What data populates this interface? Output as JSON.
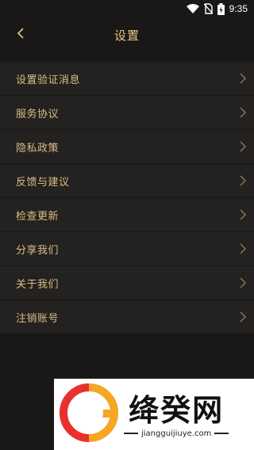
{
  "status": {
    "time": "9:35",
    "icons": [
      "wifi-icon",
      "no-sim-icon",
      "battery-charging-icon"
    ]
  },
  "header": {
    "title": "设置",
    "back_icon": "chevron-left-icon"
  },
  "menu": {
    "items": [
      {
        "label": "设置验证消息"
      },
      {
        "label": "服务协议"
      },
      {
        "label": "隐私政策"
      },
      {
        "label": "反馈与建议"
      },
      {
        "label": "检查更新"
      },
      {
        "label": "分享我们"
      },
      {
        "label": "关于我们"
      },
      {
        "label": "注销账号"
      }
    ],
    "chevron_icon": "chevron-right-icon"
  },
  "watermark": {
    "name": "绛癸网",
    "url": "jiangguijiuye.com"
  },
  "colors": {
    "background": "#1a1816",
    "menu_background": "#242220",
    "accent": "#d9bd85",
    "title": "#e8c88a"
  }
}
